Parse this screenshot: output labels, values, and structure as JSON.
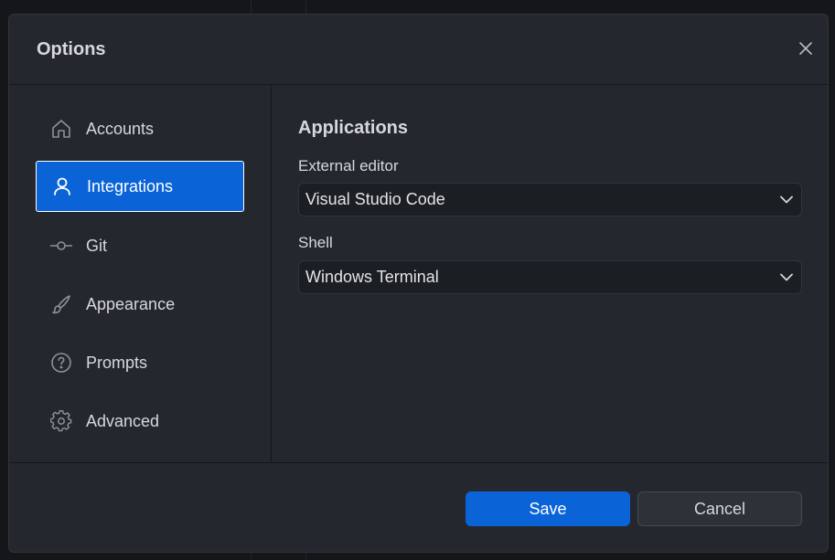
{
  "dialog": {
    "title": "Options",
    "close_icon": "close-icon"
  },
  "sidebar": {
    "items": [
      {
        "label": "Accounts",
        "icon": "home-icon",
        "active": false
      },
      {
        "label": "Integrations",
        "icon": "user-icon",
        "active": true
      },
      {
        "label": "Git",
        "icon": "git-commit-icon",
        "active": false
      },
      {
        "label": "Appearance",
        "icon": "brush-icon",
        "active": false
      },
      {
        "label": "Prompts",
        "icon": "question-icon",
        "active": false
      },
      {
        "label": "Advanced",
        "icon": "gear-icon",
        "active": false
      }
    ]
  },
  "content": {
    "section_title": "Applications",
    "external_editor": {
      "label": "External editor",
      "value": "Visual Studio Code"
    },
    "shell": {
      "label": "Shell",
      "value": "Windows Terminal"
    }
  },
  "footer": {
    "save_label": "Save",
    "cancel_label": "Cancel"
  },
  "colors": {
    "accent": "#0a64d8",
    "dialog_bg": "#24282e",
    "page_bg": "#141619"
  }
}
